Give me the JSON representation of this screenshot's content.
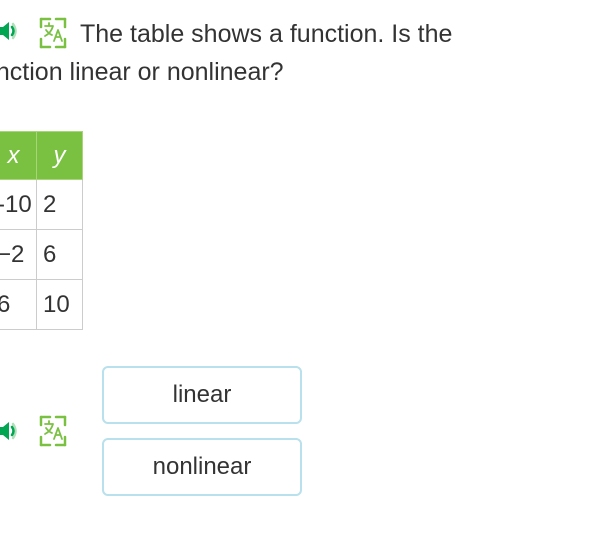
{
  "question": {
    "line1": "The table shows a function. Is the",
    "line2": "unction linear or nonlinear?"
  },
  "table": {
    "headers": {
      "x": "x",
      "y": "y"
    },
    "rows": [
      {
        "x": "-10",
        "y": "2"
      },
      {
        "x": "−2",
        "y": "6"
      },
      {
        "x": "6",
        "y": "10"
      }
    ]
  },
  "answers": {
    "linear": "linear",
    "nonlinear": "nonlinear"
  },
  "chart_data": {
    "type": "table",
    "columns": [
      "x",
      "y"
    ],
    "rows": [
      [
        -10,
        2
      ],
      [
        -2,
        6
      ],
      [
        6,
        10
      ]
    ]
  }
}
